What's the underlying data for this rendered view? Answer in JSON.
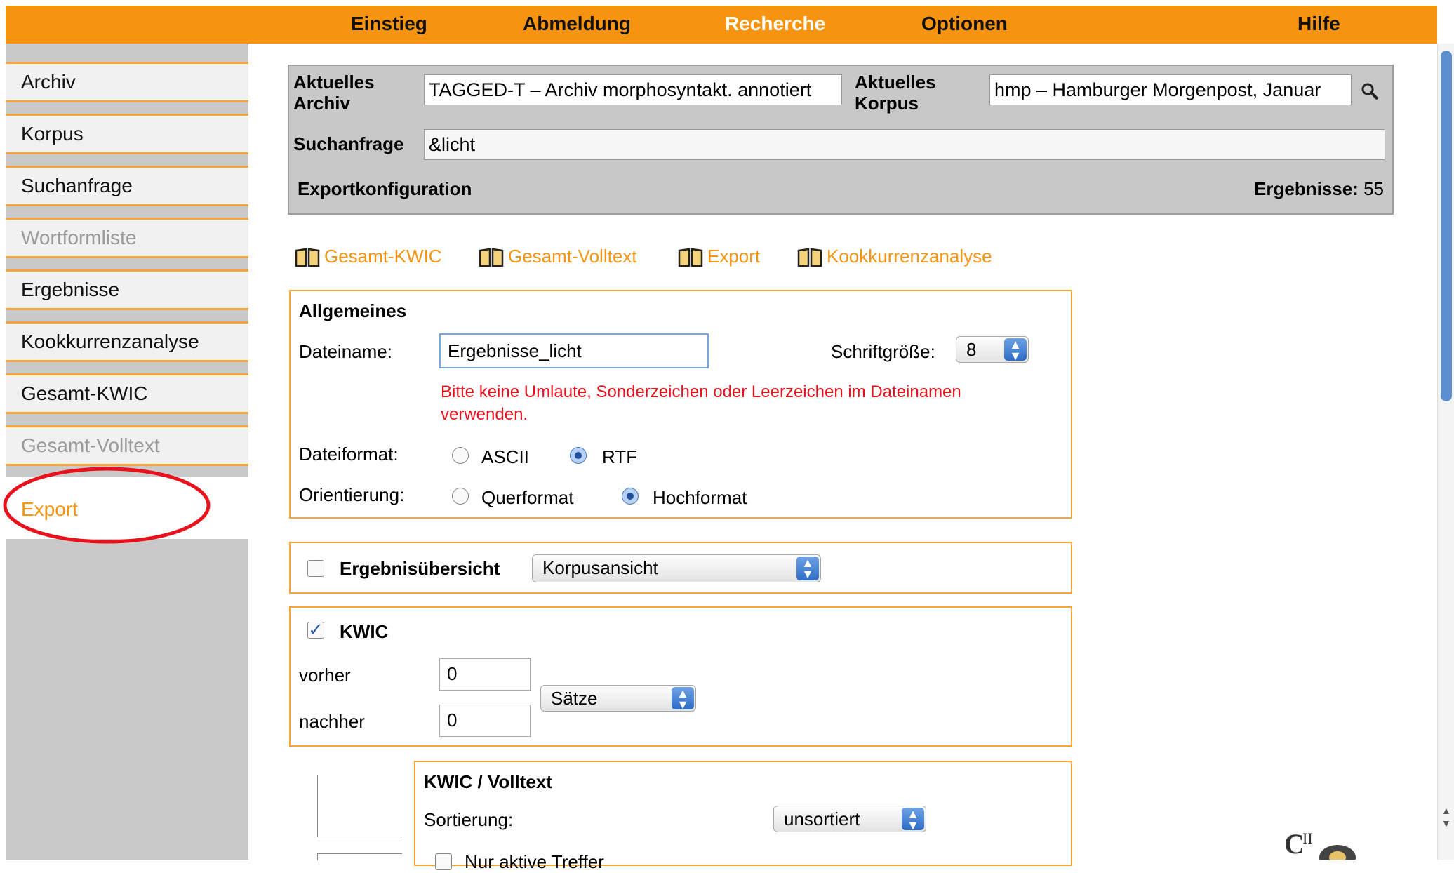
{
  "topnav": [
    "Einstieg",
    "Abmeldung",
    "Recherche",
    "Optionen",
    "Hilfe"
  ],
  "sidebar": [
    "Archiv",
    "Korpus",
    "Suchanfrage",
    "Wortformliste",
    "Ergebnisse",
    "Kookkurrenzanalyse",
    "Gesamt-KWIC",
    "Gesamt-Volltext",
    "Export"
  ],
  "info": {
    "archiv_label": "Aktuelles Archiv",
    "archiv_value": "TAGGED-T – Archiv morphosyntakt. annotiert",
    "korpus_label": "Aktuelles Korpus",
    "korpus_value": "hmp – Hamburger Morgenpost, Januar",
    "suchanfrage_label": "Suchanfrage",
    "suchanfrage_value": "&licht",
    "exportkonfig": "Exportkonfiguration",
    "ergebnisse_label": "Ergebnisse:",
    "ergebnisse_count": "55"
  },
  "actions": [
    "Gesamt-KWIC",
    "Gesamt-Volltext",
    "Export",
    "Kookkurrenzanalyse"
  ],
  "allgemeines": {
    "title": "Allgemeines",
    "dateiname_label": "Dateiname:",
    "dateiname_value": "Ergebnisse_licht",
    "schriftgroesse_label": "Schriftgröße:",
    "schriftgroesse_value": "8",
    "hint_line1": "Bitte keine Umlaute, Sonderzeichen oder Leerzeichen im Dateinamen",
    "hint_line2": "verwenden.",
    "dateiformat_label": "Dateiformat:",
    "ascii": "ASCII",
    "rtf": "RTF",
    "orientierung_label": "Orientierung:",
    "querformat": "Querformat",
    "hochformat": "Hochformat"
  },
  "ergebnisuebersicht": {
    "label": "Ergebnisübersicht",
    "select": "Korpusansicht"
  },
  "kwic": {
    "label": "KWIC",
    "vorher_label": "vorher",
    "vorher_value": "0",
    "nachher_label": "nachher",
    "nachher_value": "0",
    "unit": "Sätze"
  },
  "kwic_volltext": {
    "title": "KWIC / Volltext",
    "sortierung_label": "Sortierung:",
    "sortierung_value": "unsortiert",
    "nur_aktive": "Nur aktive Treffer"
  },
  "colors": {
    "orange": "#f7940f",
    "annotation_red": "#e8111c"
  }
}
